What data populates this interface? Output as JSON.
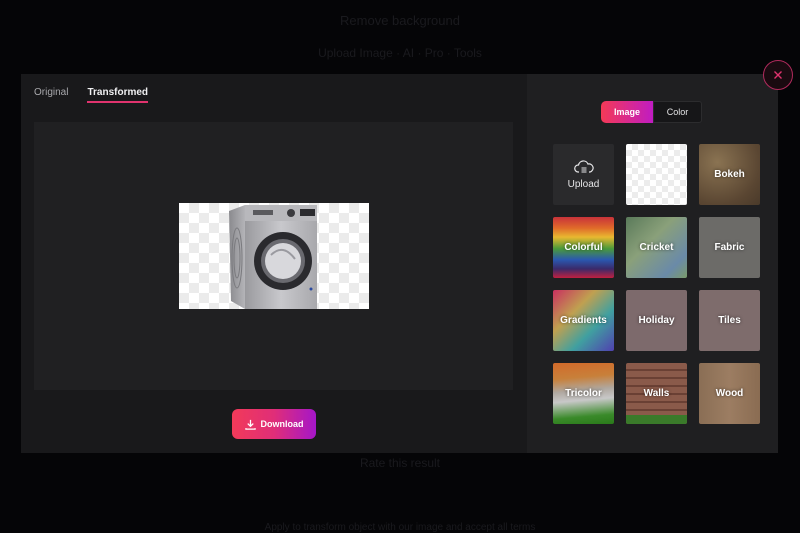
{
  "background": {
    "title": "Remove background",
    "nav": "Upload Image · AI · Pro · Tools",
    "footer": "Rate this result",
    "footer_small": "Apply to transform object with our image and accept all terms"
  },
  "modal": {
    "tabs": [
      {
        "label": "Original",
        "active": false
      },
      {
        "label": "Transformed",
        "active": true
      }
    ],
    "preview": {
      "subject": "Front-load washing machine (background removed)"
    },
    "download_label": "Download",
    "close_label": "×"
  },
  "backgrounds_panel": {
    "segments": [
      {
        "label": "Image",
        "active": true
      },
      {
        "label": "Color",
        "active": false
      }
    ],
    "tiles": [
      {
        "label": "Upload",
        "kind": "upload",
        "icon": "cloud-upload-icon"
      },
      {
        "label": "",
        "kind": "transparent"
      },
      {
        "label": "Bokeh",
        "kind": "bokeh"
      },
      {
        "label": "Colorful",
        "kind": "colorful"
      },
      {
        "label": "Cricket",
        "kind": "cricket"
      },
      {
        "label": "Fabric",
        "kind": "fabric"
      },
      {
        "label": "Gradients",
        "kind": "gradients"
      },
      {
        "label": "Holiday",
        "kind": "holiday"
      },
      {
        "label": "Tiles",
        "kind": "tiles"
      },
      {
        "label": "Tricolor",
        "kind": "tricolor"
      },
      {
        "label": "Walls",
        "kind": "walls"
      },
      {
        "label": "Wood",
        "kind": "wood"
      }
    ]
  },
  "colors": {
    "accent_pink": "#e0336e",
    "gradient_start": "#f23a59",
    "gradient_end": "#a516c9",
    "close_ring": "#b02a5c"
  }
}
